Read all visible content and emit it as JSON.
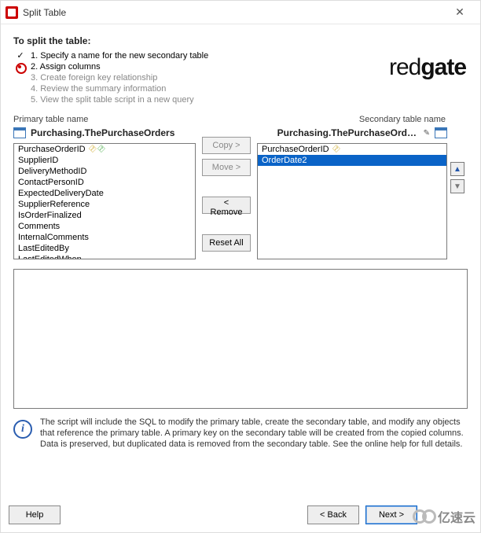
{
  "window": {
    "title": "Split Table"
  },
  "heading": "To split the table:",
  "steps": [
    {
      "label": "1. Specify a name for the new secondary table",
      "state": "done"
    },
    {
      "label": "2. Assign columns",
      "state": "active"
    },
    {
      "label": "3. Create foreign key relationship",
      "state": "future"
    },
    {
      "label": "4. Review the summary information",
      "state": "future"
    },
    {
      "label": "5. View the split table script in a new query",
      "state": "future"
    }
  ],
  "logo": {
    "left": "red",
    "right": "gate"
  },
  "primary": {
    "label": "Primary table name",
    "name": "Purchasing.ThePurchaseOrders",
    "columns": [
      {
        "name": "PurchaseOrderID",
        "keys": [
          "gold",
          "green"
        ]
      },
      {
        "name": "SupplierID"
      },
      {
        "name": "DeliveryMethodID"
      },
      {
        "name": "ContactPersonID"
      },
      {
        "name": "ExpectedDeliveryDate"
      },
      {
        "name": "SupplierReference"
      },
      {
        "name": "IsOrderFinalized"
      },
      {
        "name": "Comments"
      },
      {
        "name": "InternalComments"
      },
      {
        "name": "LastEditedBy"
      },
      {
        "name": "LastEditedWhen"
      }
    ]
  },
  "secondary": {
    "label": "Secondary table name",
    "name": "Purchasing.ThePurchaseOrders…",
    "columns": [
      {
        "name": "PurchaseOrderID",
        "keys": [
          "gold"
        ],
        "selected": false
      },
      {
        "name": "OrderDate2",
        "selected": true
      }
    ]
  },
  "buttons": {
    "copy": "Copy >",
    "move": "Move >",
    "remove": "< Remove",
    "reset": "Reset All",
    "copy_enabled": false,
    "move_enabled": false,
    "remove_enabled": true,
    "reset_enabled": true
  },
  "info": "The script will include the SQL to modify the primary table, create the secondary table, and modify any objects that reference the primary table. A primary key on the secondary table will be created from the copied columns. Data is preserved, but duplicated data is removed from the secondary table. See the online help for full details.",
  "footer": {
    "help": "Help",
    "back": "< Back",
    "next": "Next >"
  },
  "watermark": "亿速云"
}
